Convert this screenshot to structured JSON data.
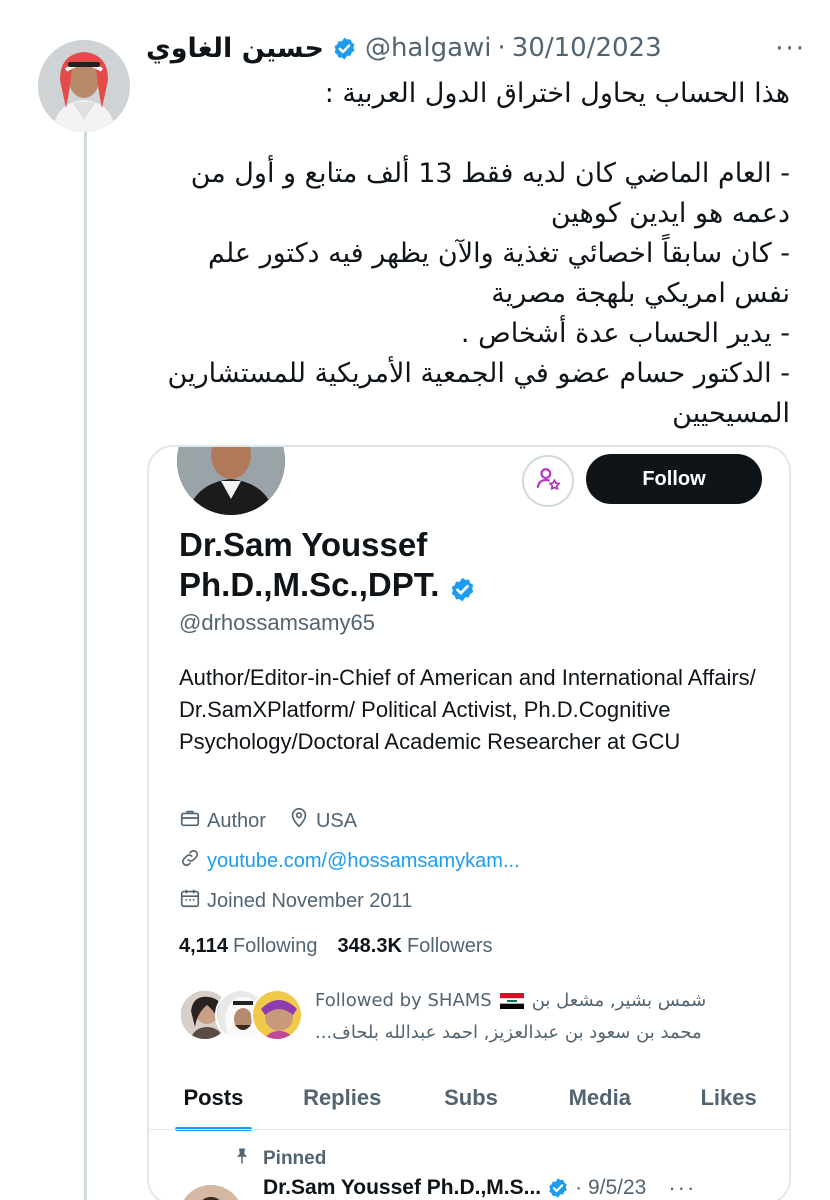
{
  "tweet": {
    "author_name": "حسين الغاوي",
    "handle": "@halgawi",
    "separator": "·",
    "date": "30/10/2023",
    "more_icon": "more-dots-icon",
    "lines": [
      "هذا الحساب يحاول اختراق الدول العربية :",
      "",
      "- العام الماضي كان لديه فقط 13 ألف متابع و أول من دعمه هو ايدين كوهين",
      "- كان سابقاً اخصائي تغذية والآن يظهر فيه دكتور علم نفس امريكي بلهجة مصرية",
      "- يدير الحساب عدة أشخاص .",
      "- الدكتور حسام عضو في الجمعية الأمريكية للمستشارين المسيحيين"
    ]
  },
  "profile": {
    "follow_label": "Follow",
    "name_line1": "Dr.Sam Youssef",
    "name_line2": "Ph.D.,M.Sc.,DPT.",
    "handle": "@drhossamsamy65",
    "bio": "Author/Editor-in-Chief of American and International Affairs/ Dr.SamXPlatform/ Political Activist, Ph.D.Cognitive Psychology/Doctoral Academic Researcher at GCU",
    "profession": "Author",
    "location": "USA",
    "website": "youtube.com/@hossamsamykam...",
    "joined": "Joined November 2011",
    "following_count": "4,114",
    "following_label": "Following",
    "followers_count": "348.3K",
    "followers_label": "Followers",
    "followed_by_prefix": "Followed by SHAMS",
    "followed_by_rest": "شمس بشير, مشعل بن",
    "followed_by_line2": "محمد بن سعود بن عبدالعزيز, احمد عبدالله بلحاف...",
    "tabs": [
      "Posts",
      "Replies",
      "Subs",
      "Media",
      "Likes"
    ],
    "active_tab": "Posts",
    "pinned_label": "Pinned",
    "pinned_author": "Dr.Sam Youssef Ph.D.,M.S...",
    "pinned_date": "· 9/5/23",
    "pinned_more": "···"
  },
  "colors": {
    "accent": "#1d9bf0",
    "follow_button": "#0f1419",
    "secondary_text": "#536471",
    "subscribe_icon": "#b335c1"
  }
}
